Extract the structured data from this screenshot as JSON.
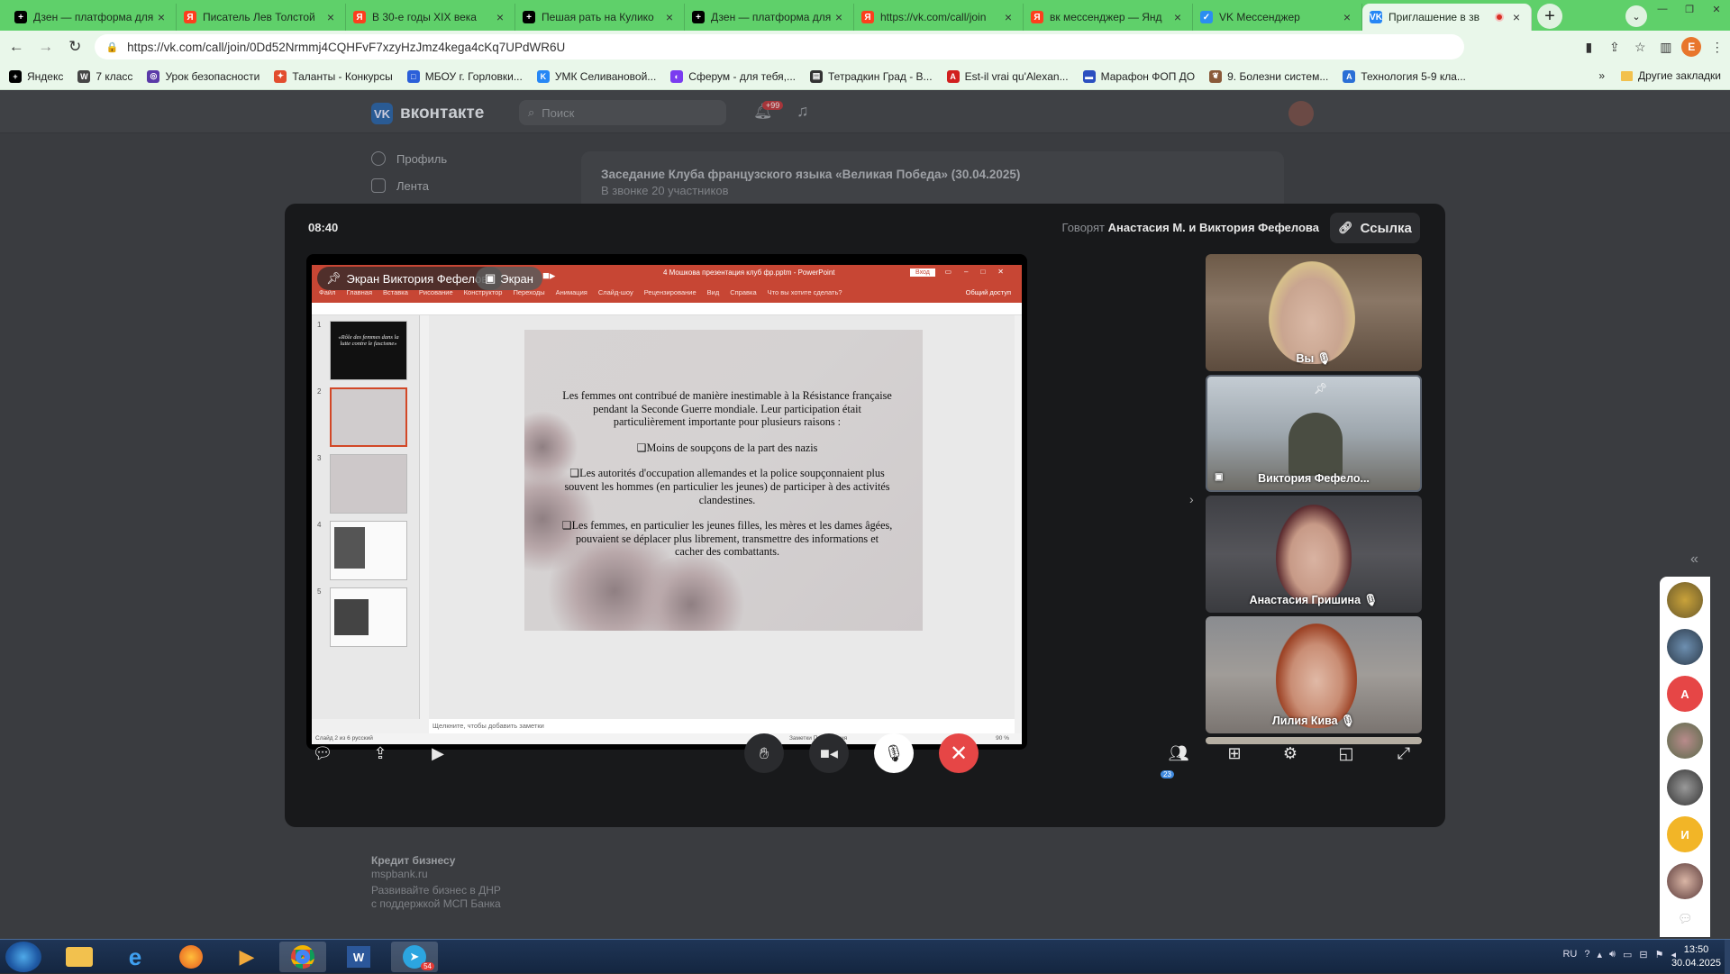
{
  "browser": {
    "tabs": [
      {
        "title": "Дзен — платформа для",
        "icon": "plus-icon",
        "color": "#000000"
      },
      {
        "title": "Писатель Лев Толстой",
        "icon": "yandex-icon",
        "color": "#fc3f1d"
      },
      {
        "title": "В 30-е годы XIX века",
        "icon": "yandex-icon",
        "color": "#fc3f1d"
      },
      {
        "title": "Пешая рать на Кулико",
        "icon": "plus-icon",
        "color": "#000000"
      },
      {
        "title": "Дзен — платформа для",
        "icon": "plus-icon",
        "color": "#000000"
      },
      {
        "title": "https://vk.com/call/join",
        "icon": "yandex-icon",
        "color": "#fc3f1d"
      },
      {
        "title": "вк мессенджер — Янд",
        "icon": "yandex-icon",
        "color": "#fc3f1d"
      },
      {
        "title": "VK Мессенджер",
        "icon": "vk-messenger-icon",
        "color": "#2b8ef0"
      },
      {
        "title": "Приглашение в зв",
        "icon": "vk-icon",
        "color": "#2787f5",
        "active": true
      }
    ],
    "url": "https://vk.com/call/join/0Dd52Nrmmj4CQHFvF7xzyHzJmz4kega4cKq7UPdWR6U",
    "profile_initial": "E",
    "bookmarks": [
      {
        "label": "Яндекс",
        "color": "#000000"
      },
      {
        "label": "7 класс",
        "color": "#464646"
      },
      {
        "label": "Урок безопасности",
        "color": "#5a3aa8"
      },
      {
        "label": "Таланты - Конкурсы",
        "color": "#e24d2e"
      },
      {
        "label": "МБОУ г. Горловки...",
        "color": "#2b5fd9"
      },
      {
        "label": "УМК Селивановой...",
        "color": "#2787f5"
      },
      {
        "label": "Сферум - для тебя,...",
        "color": "#7a3cf0"
      },
      {
        "label": "Тетрадкин Град - В...",
        "color": "#333333"
      },
      {
        "label": "Est-il vrai qu'Alexan...",
        "color": "#d1201f"
      },
      {
        "label": "Марафон ФОП ДО",
        "color": "#2b4fc0"
      },
      {
        "label": "9. Болезни систем...",
        "color": "#8a5a3a"
      },
      {
        "label": "Технология 5-9 кла...",
        "color": "#2a6fd6"
      }
    ],
    "other_bookmarks": "Другие закладки"
  },
  "vk": {
    "logo": "вконтакте",
    "search_placeholder": "Поиск",
    "notif_count": "+99",
    "menu": [
      "Профиль",
      "Лента"
    ],
    "conf_title": "Заседание Клуба французского языка «Великая Победа» (30.04.2025)",
    "conf_sub": "В звонке 20 участников",
    "ad": {
      "title": "Кредит бизнесу",
      "domain": "mspbank.ru",
      "text": "Развивайте бизнес в ДНР с поддержкой МСП Банка"
    }
  },
  "call": {
    "timer": "08:40",
    "speaking_label": "Говорят",
    "speaking_names": "Анастасия М. и Виктория Фефелова",
    "link_label": "Ссылка",
    "share_label": "Экран Виктория Фефелова",
    "screen_btn": "Экран",
    "participants": [
      {
        "name": "Вы",
        "muted": true
      },
      {
        "name": "Виктория Фефело...",
        "pinned": true
      },
      {
        "name": "Анастасия Гришина",
        "muted": true
      },
      {
        "name": "Лилия Кива",
        "muted": true
      }
    ],
    "participants_count": "23"
  },
  "ppt": {
    "file": "4 Мошкова презентация клуб фр.pptm  -  PowerPoint",
    "signin": "Вход",
    "menu": [
      "Файл",
      "Главная",
      "Вставка",
      "Рисование",
      "Конструктор",
      "Переходы",
      "Анимация",
      "Слайд-шоу",
      "Рецензирование",
      "Вид",
      "Справка",
      "Что вы хотите сделать?"
    ],
    "share": "Общий доступ",
    "thumb1": "«Rôle des femmes dans la lutte contre le fascisme»",
    "slide_paragraphs": [
      "Les femmes ont contribué de manière inestimable à la Résistance française pendant la Seconde Guerre mondiale. Leur participation était particulièrement importante pour plusieurs raisons :",
      "❑Moins de soupçons de la part des nazis",
      "❑Les autorités d'occupation allemandes et la police soupçonnaient plus souvent les hommes (en particulier les jeunes) de participer à des activités clandestines.",
      "❑Les femmes, en particulier les jeunes filles, les mères et les dames âgées, pouvaient se déplacer plus librement, transmettre des informations et cacher des combattants."
    ],
    "notes": "Щелкните, чтобы добавить заметки",
    "status": "Слайд 2 из 6     русский",
    "status_right": "Заметки     Примечания",
    "zoom": "90 %"
  },
  "taskbar": {
    "lang": "RU",
    "time": "13:50",
    "date": "30.04.2025",
    "telegram_badge": "54"
  }
}
